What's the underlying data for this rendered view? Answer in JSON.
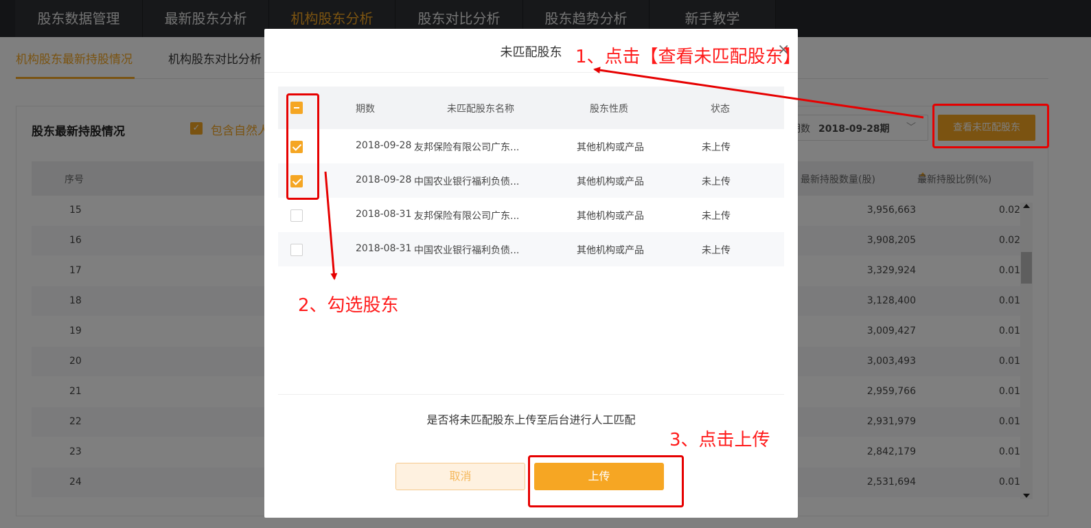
{
  "topnav": {
    "tabs": [
      "股东数据管理",
      "最新股东分析",
      "机构股东分析",
      "股东对比分析",
      "股东趋势分析",
      "新手教学"
    ]
  },
  "subtabs": [
    "机构股东最新持股情况",
    "机构股东对比分析"
  ],
  "panel": {
    "title": "股东最新持股情况",
    "include_label": "包含自然人",
    "period_label": "期数",
    "period_value": "2018-09-28期",
    "view_unmatched_button": "查看未匹配股东"
  },
  "table": {
    "headers": {
      "index": "序号",
      "qty": "最新持股数量(股)",
      "pct": "最新持股比例(%)"
    },
    "rows": [
      {
        "idx": "15",
        "qty": "3,956,663",
        "pct": "0.02"
      },
      {
        "idx": "16",
        "qty": "3,908,205",
        "pct": "0.02"
      },
      {
        "idx": "17",
        "qty": "3,329,924",
        "pct": "0.01"
      },
      {
        "idx": "18",
        "qty": "3,128,400",
        "pct": "0.01"
      },
      {
        "idx": "19",
        "qty": "3,009,427",
        "pct": "0.01"
      },
      {
        "idx": "20",
        "qty": "3,003,493",
        "pct": "0.01"
      },
      {
        "idx": "21",
        "qty": "2,959,766",
        "pct": "0.01"
      },
      {
        "idx": "22",
        "qty": "2,931,979",
        "pct": "0.01"
      },
      {
        "idx": "23",
        "qty": "2,842,179",
        "pct": "0.01"
      },
      {
        "idx": "24",
        "qty": "2,531,694",
        "pct": "0.01"
      }
    ]
  },
  "modal": {
    "title": "未匹配股东",
    "close": "×",
    "headers": {
      "period": "期数",
      "name": "未匹配股东名称",
      "type": "股东性质",
      "status": "状态"
    },
    "rows": [
      {
        "checked": true,
        "period": "2018-09-28",
        "name": "友邦保险有限公司广东...",
        "type": "其他机构或产品",
        "status": "未上传"
      },
      {
        "checked": true,
        "period": "2018-09-28",
        "name": "中国农业银行福利负债...",
        "type": "其他机构或产品",
        "status": "未上传"
      },
      {
        "checked": false,
        "period": "2018-08-31",
        "name": "友邦保险有限公司广东...",
        "type": "其他机构或产品",
        "status": "未上传"
      },
      {
        "checked": false,
        "period": "2018-08-31",
        "name": "中国农业银行福利负债...",
        "type": "其他机构或产品",
        "status": "未上传"
      }
    ],
    "question": "是否将未匹配股东上传至后台进行人工匹配",
    "cancel": "取消",
    "upload": "上传"
  },
  "annotations": {
    "step1": "1、点击【查看未匹配股东】",
    "step2": "2、勾选股东",
    "step3": "3、点击上传",
    "color": "#e60000"
  },
  "colors": {
    "accent": "#f5a623",
    "nav_bg": "#26282c"
  }
}
